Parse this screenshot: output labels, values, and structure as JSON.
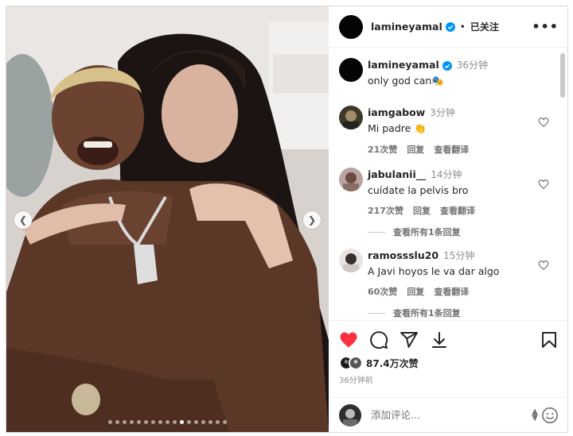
{
  "post": {
    "username": "lamineyamal",
    "follow_state": "已关注",
    "more_label": "•••",
    "carousel": {
      "dot_count": 17,
      "active_index": 10
    }
  },
  "caption": {
    "username": "lamineyamal",
    "time": "36分钟",
    "text": "only god can🎭"
  },
  "comments": [
    {
      "username": "iamgabow",
      "time": "3分钟",
      "text": "Mi padre 👏",
      "likes": "21次赞",
      "reply": "回复",
      "translate": "查看翻译",
      "view_replies": ""
    },
    {
      "username": "jabulanii__",
      "time": "14分钟",
      "text": "cuídate la pelvis bro",
      "likes": "217次赞",
      "reply": "回复",
      "translate": "查看翻译",
      "view_replies": "查看所有1条回复"
    },
    {
      "username": "ramossslu20",
      "time": "15分钟",
      "text": "A Javi hoyos le va dar algo",
      "likes": "60次赞",
      "reply": "回复",
      "translate": "查看翻译",
      "view_replies": "查看所有1条回复"
    }
  ],
  "engagement": {
    "likes_total": "87.4万次赞",
    "posted_ago": "36分钟前",
    "liked": true
  },
  "compose": {
    "placeholder": "添加评论..."
  },
  "colors": {
    "verified": "#0095f6",
    "liked_heart": "#ff3040",
    "secondary_text": "#737373"
  }
}
